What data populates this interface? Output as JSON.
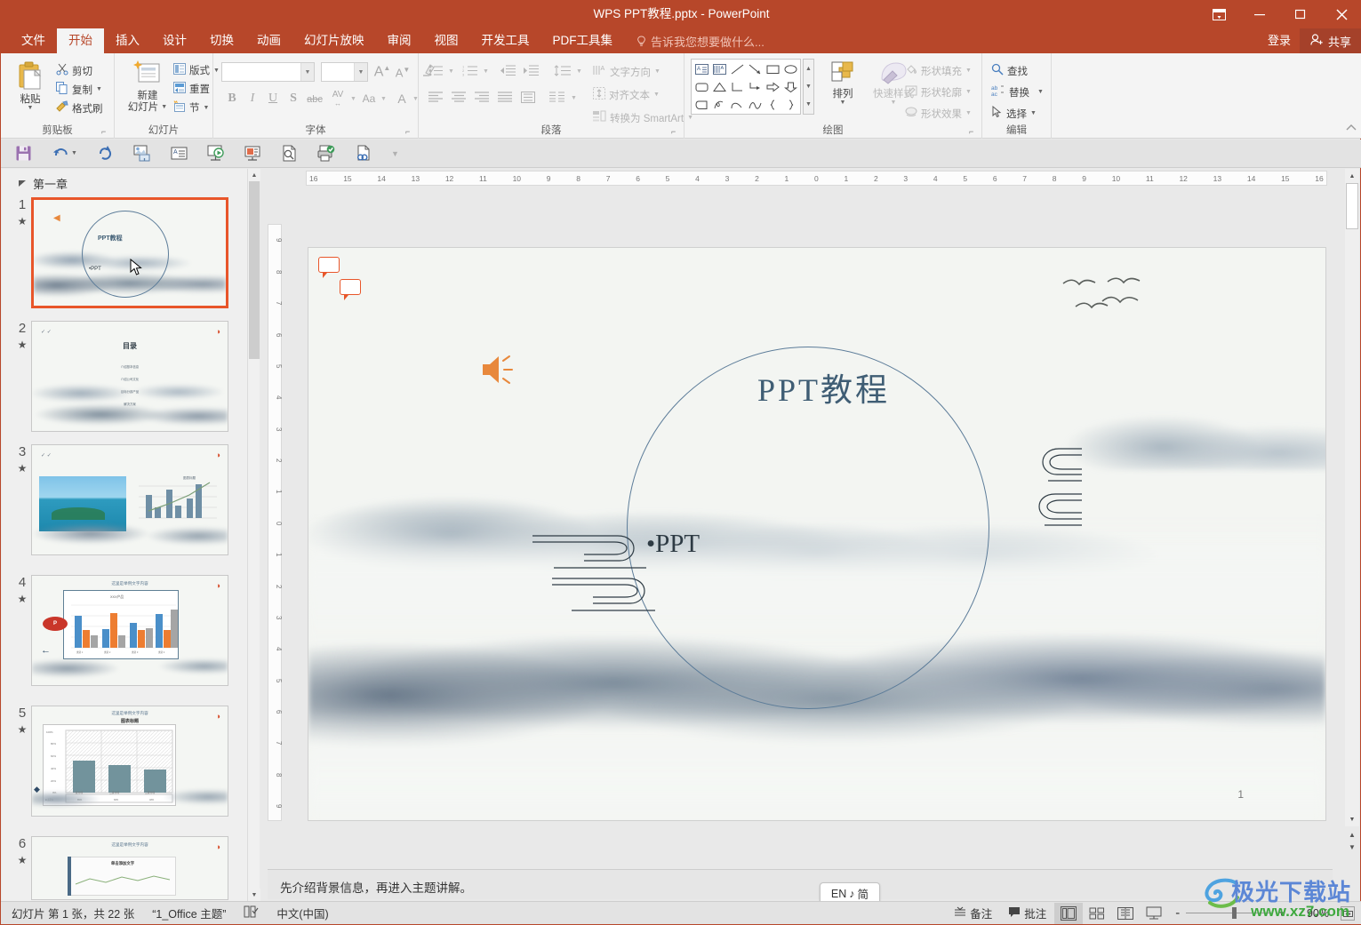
{
  "window": {
    "title": "WPS PPT教程.pptx - PowerPoint",
    "ribbon_display_icon": "ribbon-display-options-icon",
    "minimize_icon": "minimize-icon",
    "maximize_icon": "maximize-icon",
    "close_icon": "close-icon"
  },
  "tabs": [
    {
      "label": "文件",
      "active": false
    },
    {
      "label": "开始",
      "active": true
    },
    {
      "label": "插入",
      "active": false
    },
    {
      "label": "设计",
      "active": false
    },
    {
      "label": "切换",
      "active": false
    },
    {
      "label": "动画",
      "active": false
    },
    {
      "label": "幻灯片放映",
      "active": false
    },
    {
      "label": "审阅",
      "active": false
    },
    {
      "label": "视图",
      "active": false
    },
    {
      "label": "开发工具",
      "active": false
    },
    {
      "label": "PDF工具集",
      "active": false
    }
  ],
  "tell_me": "告诉我您想要做什么...",
  "account": {
    "sign_in": "登录",
    "share": "共享"
  },
  "ribbon": {
    "clipboard": {
      "group_label": "剪贴板",
      "paste": "粘贴",
      "cut": "剪切",
      "copy": "复制",
      "format_painter": "格式刷"
    },
    "slides": {
      "group_label": "幻灯片",
      "new_slide": "新建\n幻灯片",
      "new_slide_line1": "新建",
      "new_slide_line2": "幻灯片",
      "layout": "版式",
      "reset": "重置",
      "section": "节"
    },
    "font": {
      "group_label": "字体",
      "font_name_value": "",
      "font_size_value": "",
      "bold": "B",
      "italic": "I",
      "underline": "U",
      "shadow": "S",
      "strikethrough": "abc",
      "char_spacing": "AV",
      "change_case": "Aa",
      "font_color": "A",
      "grow_font": "A",
      "shrink_font": "A",
      "clear_format": "clear-formatting-icon"
    },
    "paragraph": {
      "group_label": "段落",
      "text_direction": "文字方向",
      "align_text": "对齐文本",
      "convert_smartart": "转换为 SmartArt"
    },
    "drawing": {
      "group_label": "绘图",
      "arrange": "排列",
      "quick_styles": "快速样式",
      "shape_fill": "形状填充",
      "shape_outline": "形状轮廓",
      "shape_effects": "形状效果"
    },
    "editing": {
      "group_label": "编辑",
      "find": "查找",
      "replace": "替换",
      "select": "选择"
    }
  },
  "quick_access": [
    {
      "name": "save-icon"
    },
    {
      "name": "undo-icon"
    },
    {
      "name": "redo-icon"
    },
    {
      "name": "start-slideshow-icon"
    },
    {
      "name": "text-box-icon"
    },
    {
      "name": "from-beginning-icon"
    },
    {
      "name": "from-current-slide-icon"
    },
    {
      "name": "print-preview-icon"
    },
    {
      "name": "quick-print-icon"
    },
    {
      "name": "hyperlink-icon"
    },
    {
      "name": "customize-qat-icon"
    }
  ],
  "thumbnail_pane": {
    "section_title": "第一章",
    "slides": [
      {
        "number": "1",
        "selected": true,
        "title": "PPT教程",
        "sub": "•PPT"
      },
      {
        "number": "2",
        "selected": false,
        "title": "目录"
      },
      {
        "number": "3",
        "selected": false,
        "title": ""
      },
      {
        "number": "4",
        "selected": false,
        "title": "这里是举例文字内容"
      },
      {
        "number": "5",
        "selected": false,
        "title": "这里是举例文字内容",
        "sub": "图表标题"
      },
      {
        "number": "6",
        "selected": false,
        "title": "这里是举例文字内容",
        "sub": "单击添加文字"
      }
    ]
  },
  "rulers": {
    "horizontal": [
      "16",
      "15",
      "14",
      "13",
      "12",
      "11",
      "10",
      "9",
      "8",
      "7",
      "6",
      "5",
      "4",
      "3",
      "2",
      "1",
      "0",
      "1",
      "2",
      "3",
      "4",
      "5",
      "6",
      "7",
      "8",
      "9",
      "10",
      "11",
      "12",
      "13",
      "14",
      "15",
      "16"
    ],
    "vertical": [
      "9",
      "8",
      "7",
      "6",
      "5",
      "4",
      "3",
      "2",
      "1",
      "0",
      "1",
      "2",
      "3",
      "4",
      "5",
      "6",
      "7",
      "8",
      "9"
    ]
  },
  "slide": {
    "title": "PPT教程",
    "subtitle": "•PPT",
    "page_number": "1",
    "audio_icon": "speaker-audio-icon",
    "comment_markers": [
      "comment-marker-1",
      "comment-marker-2"
    ]
  },
  "notes": {
    "text": "先介绍背景信息，再进入主题讲解。"
  },
  "ime": {
    "lang": "EN",
    "music": "♪",
    "mode": "简"
  },
  "status_bar": {
    "slide_count": "幻灯片 第 1 张，共 22 张",
    "theme": "“1_Office 主题”",
    "spellcheck_icon": "spell-check-icon",
    "language": "中文(中国)",
    "notes_button": "备注",
    "comments_button": "批注",
    "views": [
      {
        "name": "normal-view-button",
        "active": true
      },
      {
        "name": "slide-sorter-view-button",
        "active": false
      },
      {
        "name": "reading-view-button",
        "active": false
      },
      {
        "name": "slideshow-view-button",
        "active": false
      }
    ],
    "zoom_out": "-",
    "zoom_in": "+",
    "zoom_level": "90%",
    "fit_to_window_icon": "fit-slide-to-window-icon"
  },
  "watermark": {
    "cn": "极光下载站",
    "url": "www.xz7.com"
  },
  "colors": {
    "accent": "#b7472a",
    "selection": "#e8562a",
    "slide_title": "#3f5d74",
    "audio_orange": "#e8883c"
  }
}
